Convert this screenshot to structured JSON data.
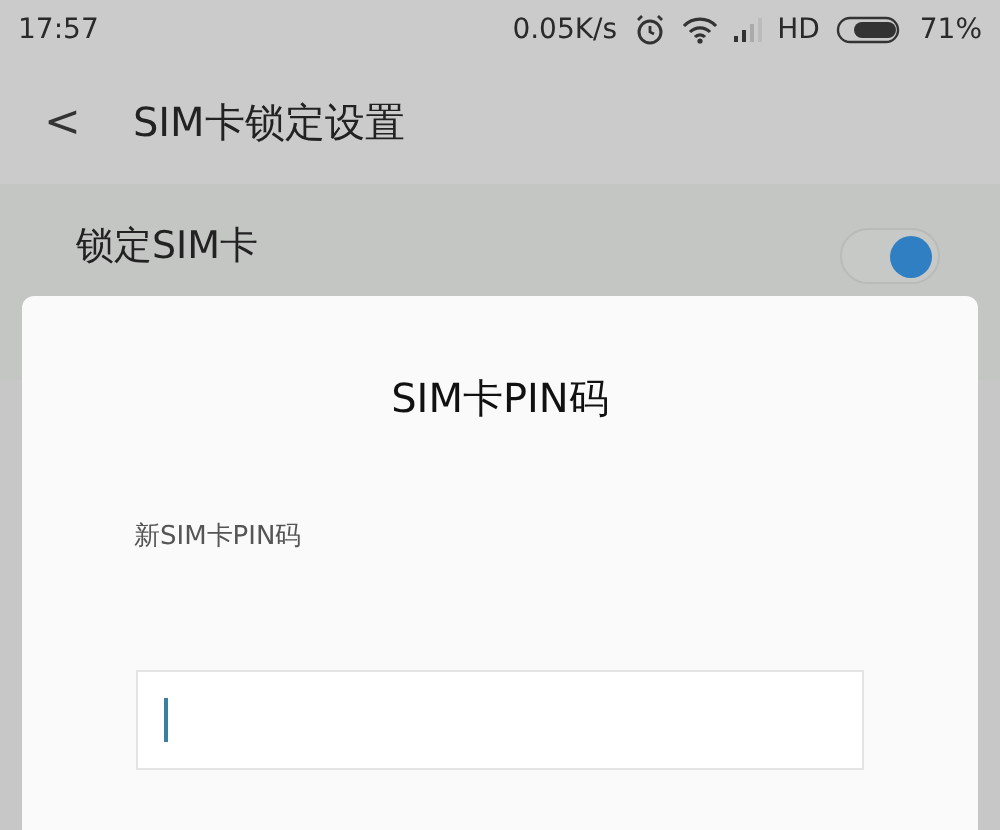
{
  "status_bar": {
    "time": "17:57",
    "speed": "0.05K/s",
    "network": "HD",
    "battery": "71%"
  },
  "header": {
    "back": "<",
    "title": "SIM卡锁定设置"
  },
  "setting": {
    "label": "锁定SIM卡",
    "on": true
  },
  "dialog": {
    "title": "SIM卡PIN码",
    "field_label": "新SIM卡PIN码",
    "focused": true
  }
}
